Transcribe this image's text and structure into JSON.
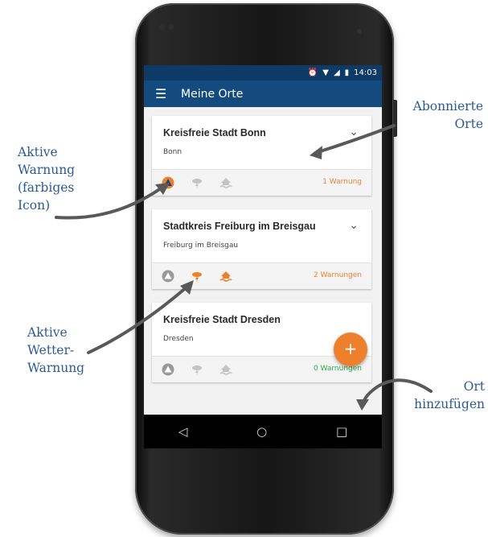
{
  "status_bar": {
    "time": "14:03",
    "alarm_icon": "alarm-icon",
    "wifi_icon": "wifi-icon",
    "signal_icon": "signal-icon",
    "battery_icon": "battery-icon"
  },
  "app_bar": {
    "title": "Meine Orte",
    "menu_icon": "hamburger-menu-icon"
  },
  "places": [
    {
      "name": "Kreisfreie Stadt Bonn",
      "subtitle": "Bonn",
      "warnings_label": "1 Warnung",
      "warnings_color": "#ee7f2d",
      "icons": [
        {
          "name": "civil-protection-icon",
          "active": true
        },
        {
          "name": "weather-icon",
          "active": false
        },
        {
          "name": "flood-icon",
          "active": false
        }
      ]
    },
    {
      "name": "Stadtkreis Freiburg im Breisgau",
      "subtitle": "Freiburg im Breisgau",
      "warnings_label": "2 Warnungen",
      "warnings_color": "#ee7f2d",
      "icons": [
        {
          "name": "civil-protection-icon",
          "active": false
        },
        {
          "name": "weather-icon",
          "active": true
        },
        {
          "name": "flood-icon",
          "active": true
        }
      ]
    },
    {
      "name": "Kreisfreie Stadt Dresden",
      "subtitle": "Dresden",
      "warnings_label": "0 Warnungen",
      "warnings_color": "#2aa84a",
      "icons": [
        {
          "name": "civil-protection-icon",
          "active": false
        },
        {
          "name": "weather-icon",
          "active": false
        },
        {
          "name": "flood-icon",
          "active": false
        }
      ]
    }
  ],
  "fab": {
    "label": "+"
  },
  "nav": {
    "back": "◁",
    "home": "○",
    "recents": "□"
  },
  "annotations": {
    "active_warning": [
      "Aktive",
      "Warnung",
      "(farbiges",
      "Icon)"
    ],
    "subscribed_places": [
      "Abonnierte",
      "Orte"
    ],
    "active_weather_warning": [
      "Aktive",
      "Wetter-",
      "Warnung"
    ],
    "add_place": [
      "Ort",
      "hinzufügen"
    ]
  },
  "colors": {
    "primary": "#134b7f",
    "status_bar": "#0d3a66",
    "accent": "#ee7f2d",
    "ok": "#2aa84a",
    "annotation": "#2b5a92"
  }
}
